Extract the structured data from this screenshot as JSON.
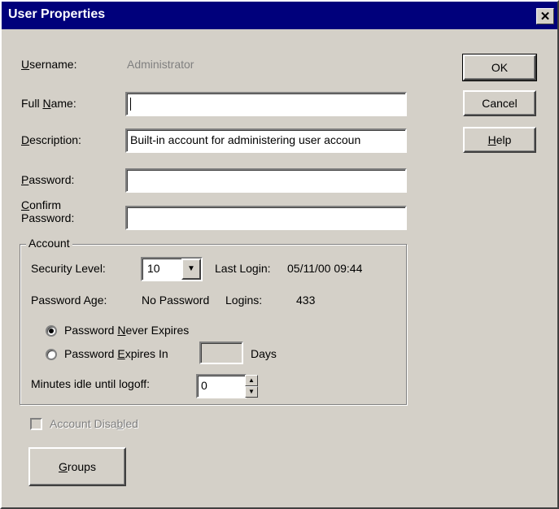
{
  "window": {
    "title": "User Properties",
    "close_glyph": "✕"
  },
  "fields": {
    "username": {
      "prefix_u": "U",
      "label_rest": "sername:",
      "value": "Administrator"
    },
    "full_name": {
      "label_pre": "Full ",
      "label_u": "N",
      "label_post": "ame:",
      "value": ""
    },
    "description": {
      "label_u": "D",
      "label_rest": "escription:",
      "value": "Built-in account for administering user accoun"
    },
    "password": {
      "label_u": "P",
      "label_rest": "assword:",
      "value": ""
    },
    "confirm_password": {
      "label_u": "C",
      "label_rest1": "onfirm",
      "label_line2": "Password:",
      "value": ""
    }
  },
  "buttons": {
    "ok": "OK",
    "cancel": "Cancel",
    "help_u": "H",
    "help_rest": "elp",
    "groups_u": "G",
    "groups_rest": "roups"
  },
  "account": {
    "group_title": "Account",
    "security_level_label": "Security Level:",
    "security_level_value": "10",
    "last_login_label": "Last Login:",
    "last_login_value": "05/11/00 09:44",
    "password_age_label": "Password Age:",
    "password_age_value": "No Password",
    "logins_label": "Logins:",
    "logins_value": "433",
    "never_expires": {
      "pre": "Password ",
      "u": "N",
      "post": "ever Expires",
      "checked": true
    },
    "expires_in": {
      "pre": "Password ",
      "u": "E",
      "post": "xpires In",
      "checked": false,
      "days_value": "",
      "days_label": "Days"
    },
    "idle_label": "Minutes idle until logoff:",
    "idle_value": "0"
  },
  "account_disabled": {
    "pre": "Account Disa",
    "u": "b",
    "post": "led",
    "checked": false,
    "enabled": false
  },
  "icons": {
    "dropdown": "chevron-down-icon",
    "spin_up": "triangle-up-icon",
    "spin_down": "triangle-down-icon"
  }
}
